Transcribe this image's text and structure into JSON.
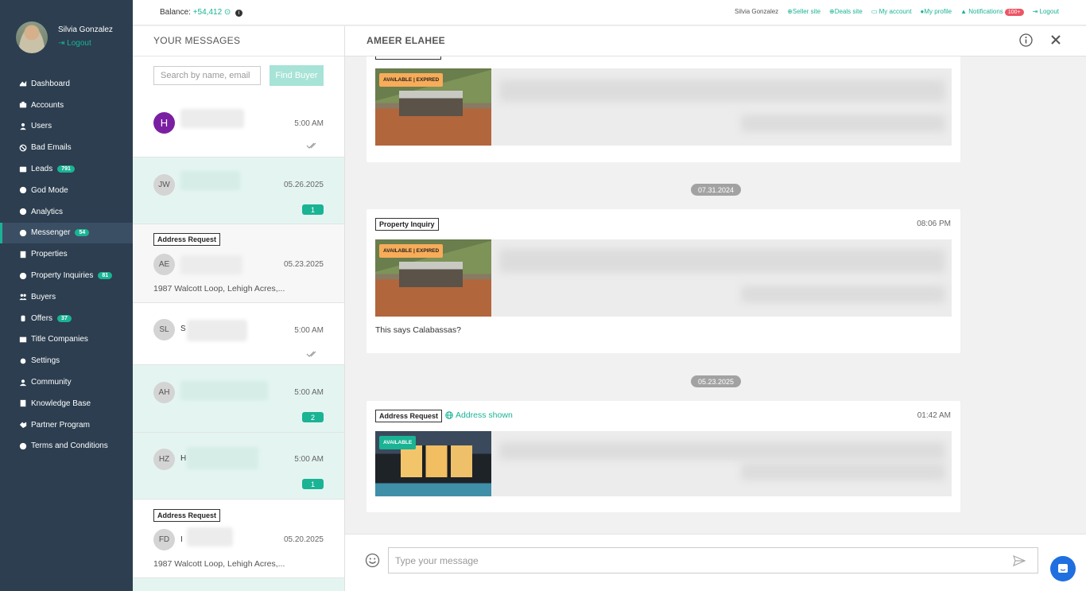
{
  "user": {
    "name": "Silvia Gonzalez",
    "logout": "Logout"
  },
  "sidebar": {
    "items": [
      {
        "label": "Dashboard",
        "icon": "dashboard-icon"
      },
      {
        "label": "Accounts",
        "icon": "briefcase-icon"
      },
      {
        "label": "Users",
        "icon": "user-icon"
      },
      {
        "label": "Bad Emails",
        "icon": "ban-icon"
      },
      {
        "label": "Leads",
        "icon": "id-card-icon",
        "badge": "791"
      },
      {
        "label": "God Mode",
        "icon": "globe-icon"
      },
      {
        "label": "Analytics",
        "icon": "globe-icon"
      },
      {
        "label": "Messenger",
        "icon": "messenger-icon",
        "badge": "54",
        "active": true
      },
      {
        "label": "Properties",
        "icon": "building-icon"
      },
      {
        "label": "Property Inquiries",
        "icon": "question-icon",
        "badge": "81"
      },
      {
        "label": "Buyers",
        "icon": "users-icon"
      },
      {
        "label": "Offers",
        "icon": "hand-icon",
        "badge": "37"
      },
      {
        "label": "Title Companies",
        "icon": "list-icon"
      },
      {
        "label": "Settings",
        "icon": "gear-icon"
      },
      {
        "label": "Community",
        "icon": "community-icon"
      },
      {
        "label": "Knowledge Base",
        "icon": "book-icon"
      },
      {
        "label": "Partner Program",
        "icon": "handshake-icon"
      },
      {
        "label": "Terms and Conditions",
        "icon": "info-icon"
      }
    ]
  },
  "topbar": {
    "balance_label": "Balance:",
    "balance_value": "+54,412",
    "user": "Silvia Gonzalez",
    "links": {
      "seller_site": "Seller site",
      "deals_site": "Deals site",
      "my_account": "My account",
      "my_profile": "My profile",
      "notifications": "Notifications",
      "notifications_badge": "100+",
      "logout": "Logout"
    }
  },
  "list": {
    "title": "YOUR MESSAGES",
    "search_placeholder": "Search by name, email",
    "find_button": "Find Buyer",
    "conversations": [
      {
        "initials": "H",
        "time": "5:00 AM",
        "read": true
      },
      {
        "initials": "JW",
        "time": "05.26.2025",
        "unread_count": "1"
      },
      {
        "initials": "AE",
        "time": "05.23.2025",
        "tag": "Address Request",
        "address": "1987 Walcott Loop, Lehigh Acres,..."
      },
      {
        "initials": "SL",
        "name_prefix": "S",
        "time": "5:00 AM",
        "read": true
      },
      {
        "initials": "AH",
        "time": "5:00 AM",
        "unread_count": "2"
      },
      {
        "initials": "HZ",
        "name_prefix": "H",
        "time": "5:00 AM",
        "unread_count": "1"
      },
      {
        "initials": "FD",
        "name_prefix": "I",
        "time": "05.20.2025",
        "tag": "Address Request",
        "address": "1987 Walcott Loop, Lehigh Acres,..."
      }
    ]
  },
  "chat": {
    "title": "AMEER ELAHEE",
    "messages": [
      {
        "property_label": "AVAILABLE | EXPIRED"
      },
      {
        "date": "07.31.2024",
        "tag": "Property Inquiry",
        "time": "08:06 PM",
        "property_label": "AVAILABLE | EXPIRED",
        "text": "This says Calabassas?"
      },
      {
        "date": "05.23.2025",
        "tag": "Address Request",
        "status": "Address shown",
        "time": "01:42 AM",
        "property_label": "AVAILABLE"
      }
    ],
    "input_placeholder": "Type your message"
  },
  "colors": {
    "sidebar": "#2c3e50",
    "accent": "#1ab394",
    "warning": "#f8ac59",
    "danger": "#ed5565"
  }
}
